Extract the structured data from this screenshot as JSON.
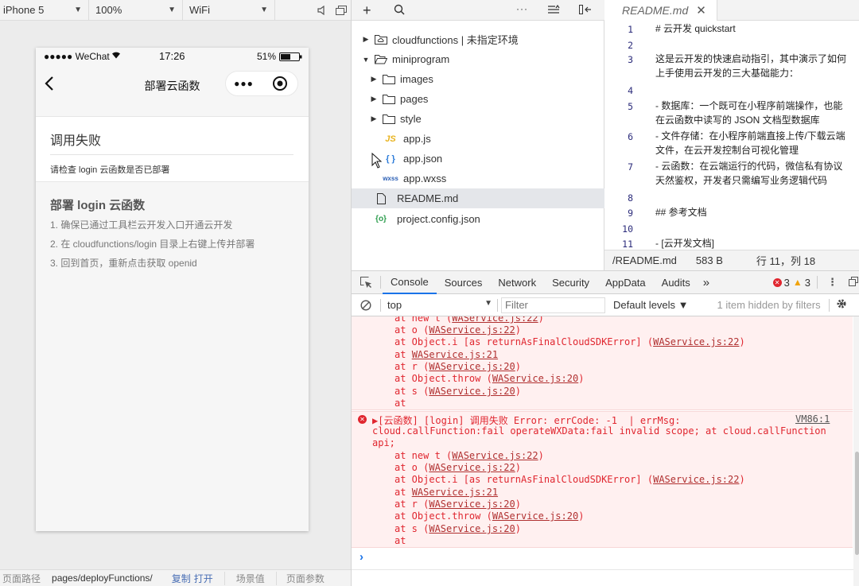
{
  "simulator_toolbar": {
    "device": "iPhone 5",
    "zoom": "100%",
    "network": "WiFi"
  },
  "phone": {
    "status_carrier": "●●●●● WeChat",
    "status_time": "17:26",
    "status_battery": "51%",
    "nav_title": "部署云函数",
    "error_title": "调用失败",
    "error_detail": "请检查 login 云函数是否已部署",
    "guide_title": "部署 login 云函数",
    "guide_steps": [
      "1. 确保已通过工具栏云开发入口开通云开发",
      "2. 在 cloudfunctions/login 目录上右键上传并部署",
      "3. 回到首页，重新点击获取 openid"
    ]
  },
  "sim_footer": {
    "path_label": "页面路径",
    "path_value": "pages/deployFunctions/",
    "copy": "复制",
    "open": "打开",
    "scene": "场景值",
    "params": "页面参数"
  },
  "file_tree": {
    "items": [
      {
        "label": "cloudfunctions | 未指定环境",
        "icon": "cloud-folder-icon",
        "expanded": false
      },
      {
        "label": "miniprogram",
        "icon": "folder-open-icon",
        "expanded": true
      },
      {
        "label": "images",
        "icon": "folder-icon",
        "expanded": false
      },
      {
        "label": "pages",
        "icon": "folder-icon",
        "expanded": false
      },
      {
        "label": "style",
        "icon": "folder-icon",
        "expanded": false
      },
      {
        "label": "app.js",
        "icon": "js-file-icon"
      },
      {
        "label": "app.json",
        "icon": "json-file-icon"
      },
      {
        "label": "app.wxss",
        "icon": "wxss-file-icon"
      },
      {
        "label": "README.md",
        "icon": "file-icon",
        "selected": true
      },
      {
        "label": "project.config.json",
        "icon": "config-file-icon"
      }
    ],
    "js_badge": "JS",
    "json_badge": "{ }",
    "wxss_badge": "wxss",
    "config_badge": "{o}"
  },
  "editor": {
    "tab_label": "README.md",
    "lines": [
      {
        "n": "1",
        "text": "# 云开发 quickstart"
      },
      {
        "n": "2",
        "text": ""
      },
      {
        "n": "3",
        "text": "这是云开发的快速启动指引，其中演示了如何上手使用云开发的三大基础能力："
      },
      {
        "n": "4",
        "text": ""
      },
      {
        "n": "5",
        "text": "- 数据库：一个既可在小程序前端操作，也能在云函数中读写的 JSON 文档型数据库"
      },
      {
        "n": "6",
        "text": "- 文件存储：在小程序前端直接上传/下载云端文件，在云开发控制台可视化管理"
      },
      {
        "n": "7",
        "text": "- 云函数：在云端运行的代码，微信私有协议天然鉴权，开发者只需编写业务逻辑代码"
      },
      {
        "n": "8",
        "text": ""
      },
      {
        "n": "9",
        "text": "## 参考文档"
      },
      {
        "n": "10",
        "text": ""
      },
      {
        "n": "11",
        "text": "- [云开发文档]"
      }
    ],
    "status_file": "/README.md",
    "status_size": "583 B",
    "status_cursor": "行 11，列 18"
  },
  "devtools": {
    "tabs": [
      "Console",
      "Sources",
      "Network",
      "Security",
      "AppData",
      "Audits"
    ],
    "more": "»",
    "error_count": "3",
    "warning_count": "3",
    "context": "top",
    "filter_placeholder": "Filter",
    "levels": "Default levels ▼",
    "hidden_note": "1 item hidden by filters"
  },
  "console": {
    "block1_trace": [
      "at new t (WAService.js:22)",
      "at o (WAService.js:22)",
      "at Object.i [as returnAsFinalCloudSDKError] (WAService.js:22)",
      "at WAService.js:21",
      "at r (WAService.js:20)",
      "at Object.throw (WAService.js:20)",
      "at s (WAService.js:20)",
      "at <anonymous>"
    ],
    "error_line1": "▶[云函数] [login] 调用失败 Error: errCode: -1  | errMsg:",
    "error_source": "VM86:1",
    "error_line2": "cloud.callFunction:fail operateWXData:fail invalid scope; at cloud.callFunction",
    "error_line3": "api;",
    "block2_trace": [
      "at new t (WAService.js:22)",
      "at o (WAService.js:22)",
      "at Object.i [as returnAsFinalCloudSDKError] (WAService.js:22)",
      "at WAService.js:21",
      "at r (WAService.js:20)",
      "at Object.throw (WAService.js:20)",
      "at s (WAService.js:20)",
      "at <anonymous>"
    ],
    "prompt": "›"
  }
}
